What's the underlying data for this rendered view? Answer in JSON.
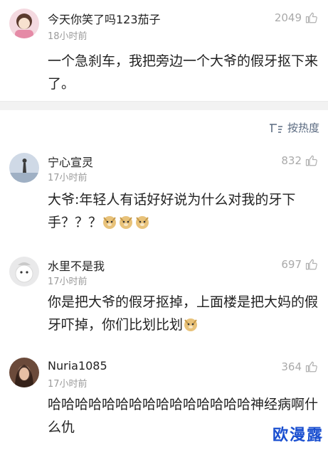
{
  "post": {
    "username": "今天你笑了吗123茄子",
    "time": "18小时前",
    "likes": "2049",
    "text": "一个急刹车，我把旁边一个大爷的假牙抠下来了。"
  },
  "sort": {
    "label": "按热度"
  },
  "comments": [
    {
      "username": "宁心宣灵",
      "time": "17小时前",
      "likes": "832",
      "text": "大爷:年轻人有话好好说为什么对我的牙下手？？？"
    },
    {
      "username": "水里不是我",
      "time": "17小时前",
      "likes": "697",
      "text": "你是把大爷的假牙抠掉，上面楼是把大妈的假牙吓掉，你们比划比划"
    },
    {
      "username": "Nuria1085",
      "time": "17小时前",
      "likes": "364",
      "text": "哈哈哈哈哈哈哈哈哈哈哈哈哈哈哈神经病啊什么仇"
    }
  ],
  "icons": {
    "like": "thumbs-up-icon",
    "sort": "sort-icon",
    "emoji": "doge-emoji-icon"
  },
  "colors": {
    "muted": "#9b9b9b",
    "sort_link": "#5a6a80",
    "watermark": "#1a4fd0"
  },
  "watermark": "欧漫露"
}
